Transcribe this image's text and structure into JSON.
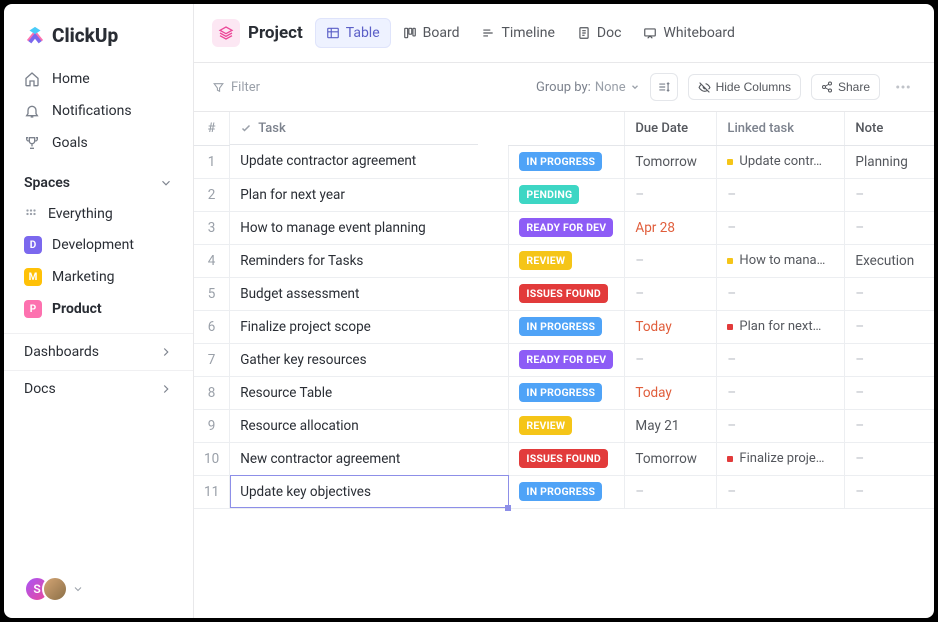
{
  "brand": "ClickUp",
  "nav": {
    "home": "Home",
    "notifications": "Notifications",
    "goals": "Goals"
  },
  "spaces": {
    "header": "Spaces",
    "everything": "Everything",
    "items": [
      {
        "letter": "D",
        "label": "Development",
        "color": "#7b68ee"
      },
      {
        "letter": "M",
        "label": "Marketing",
        "color": "#ffc107"
      },
      {
        "letter": "P",
        "label": "Product",
        "color": "#fd71af"
      }
    ]
  },
  "sections": {
    "dashboards": "Dashboards",
    "docs": "Docs"
  },
  "avatar_initial": "S",
  "project": {
    "title": "Project",
    "views": [
      {
        "label": "Table",
        "active": true
      },
      {
        "label": "Board",
        "active": false
      },
      {
        "label": "Timeline",
        "active": false
      },
      {
        "label": "Doc",
        "active": false
      },
      {
        "label": "Whiteboard",
        "active": false
      }
    ]
  },
  "toolbar": {
    "filter": "Filter",
    "group_by_label": "Group by:",
    "group_by_value": "None",
    "hide_columns": "Hide Columns",
    "share": "Share"
  },
  "columns": {
    "num": "#",
    "task": "Task",
    "due": "Due Date",
    "linked": "Linked task",
    "note": "Note"
  },
  "status_colors": {
    "IN PROGRESS": "#4fa3f7",
    "PENDING": "#3dd6c4",
    "READY FOR DEV": "#8d5cf6",
    "REVIEW": "#f5c518",
    "ISSUES FOUND": "#e23b3b"
  },
  "rows": [
    {
      "n": "1",
      "task": "Update contractor agreement",
      "status": "IN PROGRESS",
      "due": "Tomorrow",
      "due_class": "",
      "linked": {
        "text": "Update contr…",
        "color": "#f5c518"
      },
      "note": "Planning"
    },
    {
      "n": "2",
      "task": "Plan for next year",
      "status": "PENDING",
      "due": "–",
      "due_class": "",
      "linked": null,
      "note": "–"
    },
    {
      "n": "3",
      "task": "How to manage event planning",
      "status": "READY FOR DEV",
      "due": "Apr 28",
      "due_class": "due-apr28",
      "linked": null,
      "note": "–"
    },
    {
      "n": "4",
      "task": "Reminders for Tasks",
      "status": "REVIEW",
      "due": "–",
      "due_class": "",
      "linked": {
        "text": "How to mana…",
        "color": "#f5c518"
      },
      "note": "Execution"
    },
    {
      "n": "5",
      "task": "Budget assessment",
      "status": "ISSUES FOUND",
      "due": "–",
      "due_class": "",
      "linked": null,
      "note": "–"
    },
    {
      "n": "6",
      "task": "Finalize project scope",
      "status": "IN PROGRESS",
      "due": "Today",
      "due_class": "due-today",
      "linked": {
        "text": "Plan for next…",
        "color": "#e23b3b"
      },
      "note": "–"
    },
    {
      "n": "7",
      "task": "Gather key resources",
      "status": "READY FOR DEV",
      "due": "–",
      "due_class": "",
      "linked": null,
      "note": "–"
    },
    {
      "n": "8",
      "task": "Resource Table",
      "status": "IN PROGRESS",
      "due": "Today",
      "due_class": "due-today",
      "linked": null,
      "note": "–"
    },
    {
      "n": "9",
      "task": "Resource allocation",
      "status": "REVIEW",
      "due": "May 21",
      "due_class": "",
      "linked": null,
      "note": "–"
    },
    {
      "n": "10",
      "task": "New contractor agreement",
      "status": "ISSUES FOUND",
      "due": "Tomorrow",
      "due_class": "",
      "linked": {
        "text": "Finalize proje…",
        "color": "#e23b3b"
      },
      "note": "–"
    },
    {
      "n": "11",
      "task": "Update key objectives",
      "status": "IN PROGRESS",
      "due": "–",
      "due_class": "",
      "linked": null,
      "note": "–",
      "editing": true
    }
  ]
}
